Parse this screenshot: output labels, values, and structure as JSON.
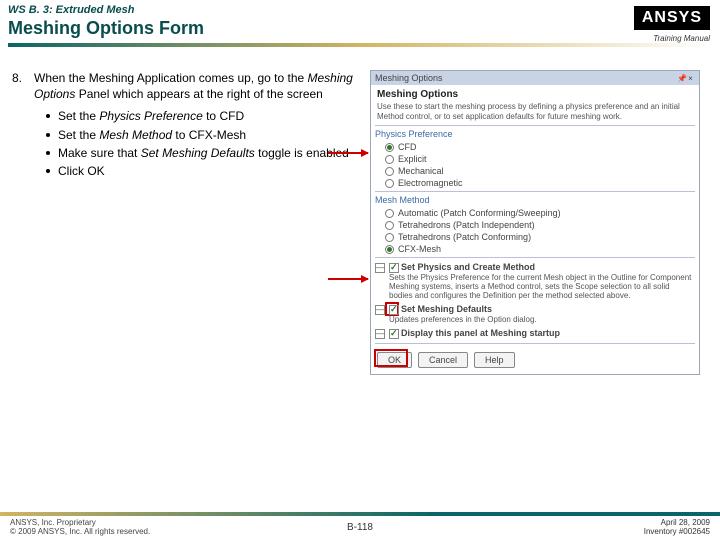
{
  "header": {
    "breadcrumb": "WS B. 3: Extruded Mesh",
    "title": "Meshing Options Form",
    "logo_text": "ANSYS",
    "training_manual": "Training Manual"
  },
  "step": {
    "number": "8.",
    "text_parts": {
      "a": "When the Meshing Application comes up, go to the ",
      "b": "Meshing Options",
      "c": " Panel which appears at the right of the screen"
    },
    "bullets": [
      {
        "a": "Set the ",
        "b": "Physics Preference",
        "c": " to CFD"
      },
      {
        "a": "Set the ",
        "b": "Mesh Method",
        "c": " to CFX-Mesh"
      },
      {
        "a": "Make sure that ",
        "b": "Set Meshing Defaults",
        "c": " toggle is enabled"
      },
      {
        "a": "Click OK",
        "b": "",
        "c": ""
      }
    ]
  },
  "panel": {
    "window_title": "Meshing Options",
    "intro_head": "Meshing Options",
    "intro_text": "Use these to start the meshing process by defining a physics preference and an initial Method control, or to set application defaults for future meshing work.",
    "group_physics": "Physics Preference",
    "physics_options": [
      "CFD",
      "Explicit",
      "Mechanical",
      "Electromagnetic"
    ],
    "physics_selected": 0,
    "group_method": "Mesh Method",
    "method_options": [
      "Automatic (Patch Conforming/Sweeping)",
      "Tetrahedrons (Patch Independent)",
      "Tetrahedrons (Patch Conforming)",
      "CFX-Mesh"
    ],
    "method_selected": 3,
    "toggle1_head": "Set Physics and Create Method",
    "toggle1_desc": "Sets the Physics Preference for the current Mesh object in the Outline for Component Meshing systems, inserts a Method control, sets the Scope selection to all solid bodies and configures the Definition per the method selected above.",
    "toggle2_head": "Set Meshing Defaults",
    "toggle2_desc": "Updates preferences in the Option dialog.",
    "toggle3_head": "Display this panel at Meshing startup",
    "buttons": {
      "ok": "OK",
      "cancel": "Cancel",
      "help": "Help"
    }
  },
  "footer": {
    "proprietary": "ANSYS, Inc. Proprietary",
    "copyright": "© 2009 ANSYS, Inc. All rights reserved.",
    "page": "B-118",
    "date": "April 28, 2009",
    "inventory": "Inventory #002645"
  }
}
